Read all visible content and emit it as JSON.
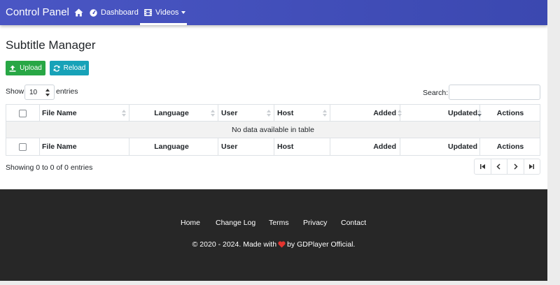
{
  "navbar": {
    "brand": "Control Panel",
    "home_icon": "home-icon",
    "dashboard_label": "Dashboard",
    "dashboard_icon": "dashboard-gauge-icon",
    "videos_label": "Videos",
    "videos_icon": "film-icon",
    "accent_color": "#3f4cbb"
  },
  "page": {
    "title": "Subtitle Manager",
    "upload_label": "Upload",
    "upload_icon": "upload-icon",
    "upload_color": "#28a745",
    "reload_label": "Reload",
    "reload_icon": "reload-icon",
    "reload_color": "#17a2b8"
  },
  "table_controls": {
    "show_label": "Show",
    "page_length": "10",
    "entries_label": "entries",
    "search_label": "Search:",
    "search_value": ""
  },
  "table": {
    "columns": [
      "",
      "File Name",
      "Language",
      "User",
      "Host",
      "Added",
      "Updated",
      "Actions"
    ],
    "sort_state": {
      "column": "Updated",
      "direction": "desc"
    },
    "empty_message": "No data available in table",
    "rows": []
  },
  "info": "Showing 0 to 0 of 0 entries",
  "pagination": {
    "buttons": [
      "first-page-icon",
      "previous-page-icon",
      "next-page-icon",
      "last-page-icon"
    ]
  },
  "footer": {
    "links": [
      "Home",
      "Change Log",
      "Terms",
      "Privacy",
      "Contact"
    ],
    "copyright_pre": "© 2020 - 2024. Made with",
    "copyright_post": "by GDPlayer Official.",
    "heart_color": "#e3342f",
    "background": "#272727"
  }
}
